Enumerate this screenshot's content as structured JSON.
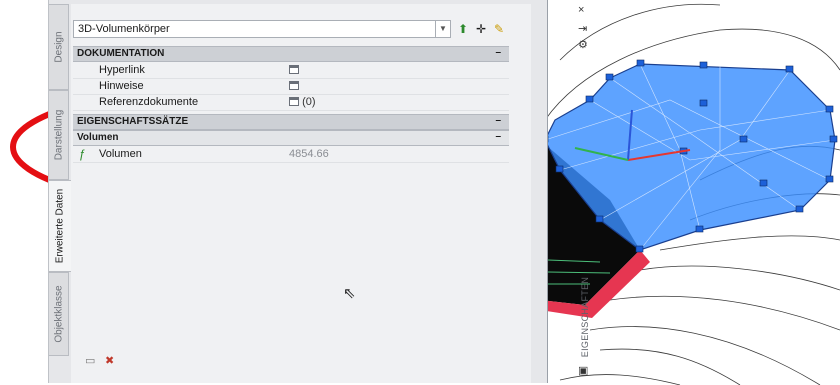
{
  "palette": {
    "tabs": [
      {
        "label": "Design",
        "active": false
      },
      {
        "label": "Darstellung",
        "active": false
      },
      {
        "label": "Erweiterte Daten",
        "active": true
      },
      {
        "label": "Objektklasse",
        "active": false
      }
    ],
    "object_type": "3D-Volumenkörper",
    "sections": {
      "documentation": {
        "title": "DOKUMENTATION",
        "collapse": "–"
      },
      "property_sets": {
        "title": "EIGENSCHAFTSSÄTZE",
        "collapse": "–"
      },
      "volume_group": {
        "title": "Volumen",
        "collapse": "–"
      }
    },
    "rows": {
      "hyperlink": {
        "label": "Hyperlink",
        "value": ""
      },
      "notes": {
        "label": "Hinweise",
        "value": ""
      },
      "ref_docs": {
        "label": "Referenzdokumente",
        "value": "(0)"
      },
      "volume": {
        "label": "Volumen",
        "value": "4854.66"
      }
    },
    "side_title": "EIGENSCHAFTEN",
    "side_buttons": {
      "close": "×",
      "pin": "⇥",
      "settings": "⚙"
    }
  },
  "colors": {
    "annotation": "#e40f13",
    "mesh_fill": "#3b8fff",
    "solid_side": "#e63651"
  }
}
